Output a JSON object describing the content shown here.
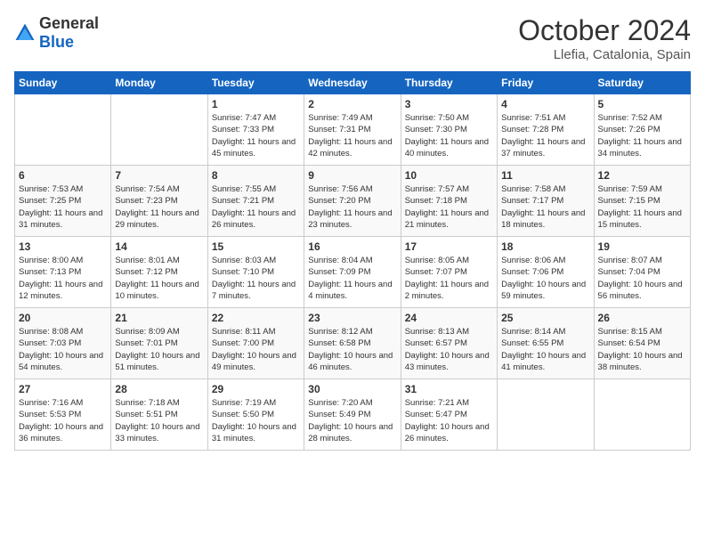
{
  "header": {
    "logo": {
      "general": "General",
      "blue": "Blue"
    },
    "month": "October 2024",
    "location": "Llefia, Catalonia, Spain"
  },
  "days_of_week": [
    "Sunday",
    "Monday",
    "Tuesday",
    "Wednesday",
    "Thursday",
    "Friday",
    "Saturday"
  ],
  "weeks": [
    [
      {
        "day": "",
        "sunrise": "",
        "sunset": "",
        "daylight": ""
      },
      {
        "day": "",
        "sunrise": "",
        "sunset": "",
        "daylight": ""
      },
      {
        "day": "1",
        "sunrise": "Sunrise: 7:47 AM",
        "sunset": "Sunset: 7:33 PM",
        "daylight": "Daylight: 11 hours and 45 minutes."
      },
      {
        "day": "2",
        "sunrise": "Sunrise: 7:49 AM",
        "sunset": "Sunset: 7:31 PM",
        "daylight": "Daylight: 11 hours and 42 minutes."
      },
      {
        "day": "3",
        "sunrise": "Sunrise: 7:50 AM",
        "sunset": "Sunset: 7:30 PM",
        "daylight": "Daylight: 11 hours and 40 minutes."
      },
      {
        "day": "4",
        "sunrise": "Sunrise: 7:51 AM",
        "sunset": "Sunset: 7:28 PM",
        "daylight": "Daylight: 11 hours and 37 minutes."
      },
      {
        "day": "5",
        "sunrise": "Sunrise: 7:52 AM",
        "sunset": "Sunset: 7:26 PM",
        "daylight": "Daylight: 11 hours and 34 minutes."
      }
    ],
    [
      {
        "day": "6",
        "sunrise": "Sunrise: 7:53 AM",
        "sunset": "Sunset: 7:25 PM",
        "daylight": "Daylight: 11 hours and 31 minutes."
      },
      {
        "day": "7",
        "sunrise": "Sunrise: 7:54 AM",
        "sunset": "Sunset: 7:23 PM",
        "daylight": "Daylight: 11 hours and 29 minutes."
      },
      {
        "day": "8",
        "sunrise": "Sunrise: 7:55 AM",
        "sunset": "Sunset: 7:21 PM",
        "daylight": "Daylight: 11 hours and 26 minutes."
      },
      {
        "day": "9",
        "sunrise": "Sunrise: 7:56 AM",
        "sunset": "Sunset: 7:20 PM",
        "daylight": "Daylight: 11 hours and 23 minutes."
      },
      {
        "day": "10",
        "sunrise": "Sunrise: 7:57 AM",
        "sunset": "Sunset: 7:18 PM",
        "daylight": "Daylight: 11 hours and 21 minutes."
      },
      {
        "day": "11",
        "sunrise": "Sunrise: 7:58 AM",
        "sunset": "Sunset: 7:17 PM",
        "daylight": "Daylight: 11 hours and 18 minutes."
      },
      {
        "day": "12",
        "sunrise": "Sunrise: 7:59 AM",
        "sunset": "Sunset: 7:15 PM",
        "daylight": "Daylight: 11 hours and 15 minutes."
      }
    ],
    [
      {
        "day": "13",
        "sunrise": "Sunrise: 8:00 AM",
        "sunset": "Sunset: 7:13 PM",
        "daylight": "Daylight: 11 hours and 12 minutes."
      },
      {
        "day": "14",
        "sunrise": "Sunrise: 8:01 AM",
        "sunset": "Sunset: 7:12 PM",
        "daylight": "Daylight: 11 hours and 10 minutes."
      },
      {
        "day": "15",
        "sunrise": "Sunrise: 8:03 AM",
        "sunset": "Sunset: 7:10 PM",
        "daylight": "Daylight: 11 hours and 7 minutes."
      },
      {
        "day": "16",
        "sunrise": "Sunrise: 8:04 AM",
        "sunset": "Sunset: 7:09 PM",
        "daylight": "Daylight: 11 hours and 4 minutes."
      },
      {
        "day": "17",
        "sunrise": "Sunrise: 8:05 AM",
        "sunset": "Sunset: 7:07 PM",
        "daylight": "Daylight: 11 hours and 2 minutes."
      },
      {
        "day": "18",
        "sunrise": "Sunrise: 8:06 AM",
        "sunset": "Sunset: 7:06 PM",
        "daylight": "Daylight: 10 hours and 59 minutes."
      },
      {
        "day": "19",
        "sunrise": "Sunrise: 8:07 AM",
        "sunset": "Sunset: 7:04 PM",
        "daylight": "Daylight: 10 hours and 56 minutes."
      }
    ],
    [
      {
        "day": "20",
        "sunrise": "Sunrise: 8:08 AM",
        "sunset": "Sunset: 7:03 PM",
        "daylight": "Daylight: 10 hours and 54 minutes."
      },
      {
        "day": "21",
        "sunrise": "Sunrise: 8:09 AM",
        "sunset": "Sunset: 7:01 PM",
        "daylight": "Daylight: 10 hours and 51 minutes."
      },
      {
        "day": "22",
        "sunrise": "Sunrise: 8:11 AM",
        "sunset": "Sunset: 7:00 PM",
        "daylight": "Daylight: 10 hours and 49 minutes."
      },
      {
        "day": "23",
        "sunrise": "Sunrise: 8:12 AM",
        "sunset": "Sunset: 6:58 PM",
        "daylight": "Daylight: 10 hours and 46 minutes."
      },
      {
        "day": "24",
        "sunrise": "Sunrise: 8:13 AM",
        "sunset": "Sunset: 6:57 PM",
        "daylight": "Daylight: 10 hours and 43 minutes."
      },
      {
        "day": "25",
        "sunrise": "Sunrise: 8:14 AM",
        "sunset": "Sunset: 6:55 PM",
        "daylight": "Daylight: 10 hours and 41 minutes."
      },
      {
        "day": "26",
        "sunrise": "Sunrise: 8:15 AM",
        "sunset": "Sunset: 6:54 PM",
        "daylight": "Daylight: 10 hours and 38 minutes."
      }
    ],
    [
      {
        "day": "27",
        "sunrise": "Sunrise: 7:16 AM",
        "sunset": "Sunset: 5:53 PM",
        "daylight": "Daylight: 10 hours and 36 minutes."
      },
      {
        "day": "28",
        "sunrise": "Sunrise: 7:18 AM",
        "sunset": "Sunset: 5:51 PM",
        "daylight": "Daylight: 10 hours and 33 minutes."
      },
      {
        "day": "29",
        "sunrise": "Sunrise: 7:19 AM",
        "sunset": "Sunset: 5:50 PM",
        "daylight": "Daylight: 10 hours and 31 minutes."
      },
      {
        "day": "30",
        "sunrise": "Sunrise: 7:20 AM",
        "sunset": "Sunset: 5:49 PM",
        "daylight": "Daylight: 10 hours and 28 minutes."
      },
      {
        "day": "31",
        "sunrise": "Sunrise: 7:21 AM",
        "sunset": "Sunset: 5:47 PM",
        "daylight": "Daylight: 10 hours and 26 minutes."
      },
      {
        "day": "",
        "sunrise": "",
        "sunset": "",
        "daylight": ""
      },
      {
        "day": "",
        "sunrise": "",
        "sunset": "",
        "daylight": ""
      }
    ]
  ]
}
